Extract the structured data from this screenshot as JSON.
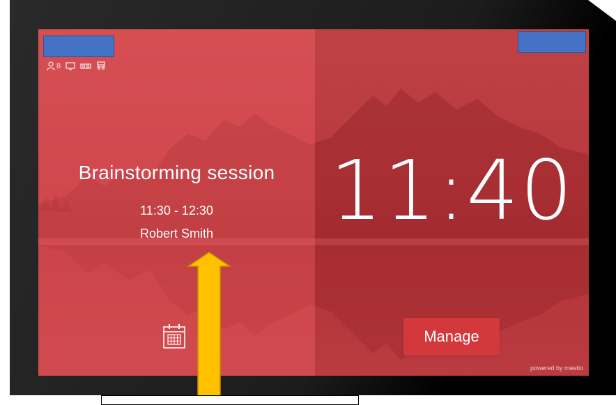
{
  "meeting": {
    "title": "Brainstorming session",
    "time_range": "11:30 - 12:30",
    "organizer": "Robert Smith"
  },
  "room": {
    "capacity": "8",
    "amenity_icons": [
      "person-icon",
      "display-icon",
      "projector-icon",
      "conference-table-icon"
    ]
  },
  "clock": {
    "current_time": "11:40"
  },
  "actions": {
    "manage_label": "Manage",
    "calendar_icon": "calendar-icon"
  },
  "footer": {
    "powered_by": "powered by meetio"
  },
  "colors": {
    "screen_red": "#c84a4e",
    "manage_button": "#d3383d",
    "redaction_tag": "#4472c4",
    "annotation_arrow": "#ffc000"
  }
}
